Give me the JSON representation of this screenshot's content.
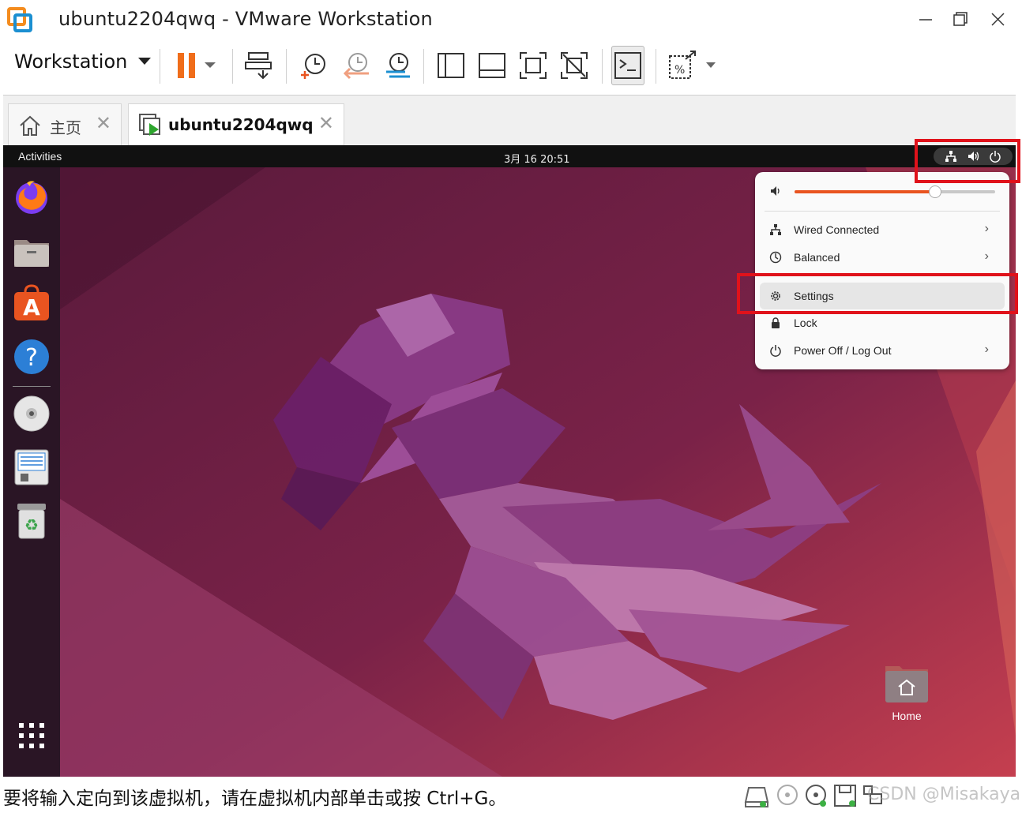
{
  "window": {
    "title": "ubuntu2204qwq - VMware Workstation"
  },
  "toolbar": {
    "workstation_menu": "Workstation"
  },
  "tabs": [
    {
      "label": "主页"
    },
    {
      "label": "ubuntu2204qwq"
    }
  ],
  "vm": {
    "topbar": {
      "activities": "Activities",
      "clock": "3月 16  20:51"
    },
    "system_menu": {
      "volume_level": 0.7,
      "items": [
        {
          "label": "Wired Connected",
          "icon": "network-wired-icon",
          "has_submenu": true
        },
        {
          "label": "Balanced",
          "icon": "power-profile-icon",
          "has_submenu": true
        },
        {
          "label": "Settings",
          "icon": "gear-icon",
          "has_submenu": false,
          "highlighted": true
        },
        {
          "label": "Lock",
          "icon": "lock-icon",
          "has_submenu": false
        },
        {
          "label": "Power Off / Log Out",
          "icon": "power-icon",
          "has_submenu": true
        }
      ]
    },
    "dock": [
      "firefox-icon",
      "files-icon",
      "software-center-icon",
      "help-icon",
      "dvd-icon",
      "text-editor-icon",
      "trash-icon",
      "show-apps-icon"
    ],
    "desktop_home_label": "Home"
  },
  "statusbar": {
    "message": "要将输入定向到该虚拟机，请在虚拟机内部单击或按 Ctrl+G。",
    "watermark": "CSDN @Misakaya"
  },
  "colors": {
    "accent": "#e95420",
    "annotation": "#e0121b",
    "pause": "#f06d1a"
  }
}
